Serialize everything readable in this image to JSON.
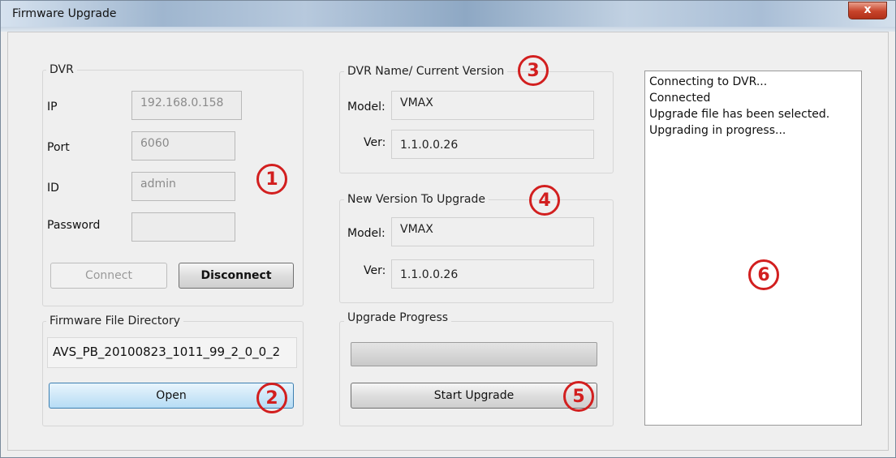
{
  "window": {
    "title": "Firmware Upgrade",
    "close_label": "x"
  },
  "dvr": {
    "group_label": "DVR",
    "ip_label": "IP",
    "ip_value": "192.168.0.158",
    "port_label": "Port",
    "port_value": "6060",
    "id_label": "ID",
    "id_value": "admin",
    "password_label": "Password",
    "password_value": "",
    "connect_label": "Connect",
    "disconnect_label": "Disconnect"
  },
  "firmware": {
    "group_label": "Firmware File Directory",
    "path": "AVS_PB_20100823_1011_99_2_0_0_2",
    "open_label": "Open"
  },
  "current": {
    "group_label": "DVR Name/ Current Version",
    "model_label": "Model:",
    "model_value": "VMAX",
    "ver_label": "Ver:",
    "ver_value": "1.1.0.0.26"
  },
  "new_version": {
    "group_label": "New Version To Upgrade",
    "model_label": "Model:",
    "model_value": "VMAX",
    "ver_label": "Ver:",
    "ver_value": "1.1.0.0.26"
  },
  "progress": {
    "group_label": "Upgrade Progress",
    "fraction": 0,
    "start_label": "Start Upgrade"
  },
  "log": {
    "lines": [
      "Connecting to DVR...",
      "Connected",
      "Upgrade file has been selected.",
      "Upgrading in progress..."
    ]
  },
  "callouts": [
    "1",
    "2",
    "3",
    "4",
    "5",
    "6"
  ],
  "colors": {
    "callout": "#d21f1f",
    "progress_fill": "#3fae3f",
    "focused_button": "#cfe8f8"
  }
}
